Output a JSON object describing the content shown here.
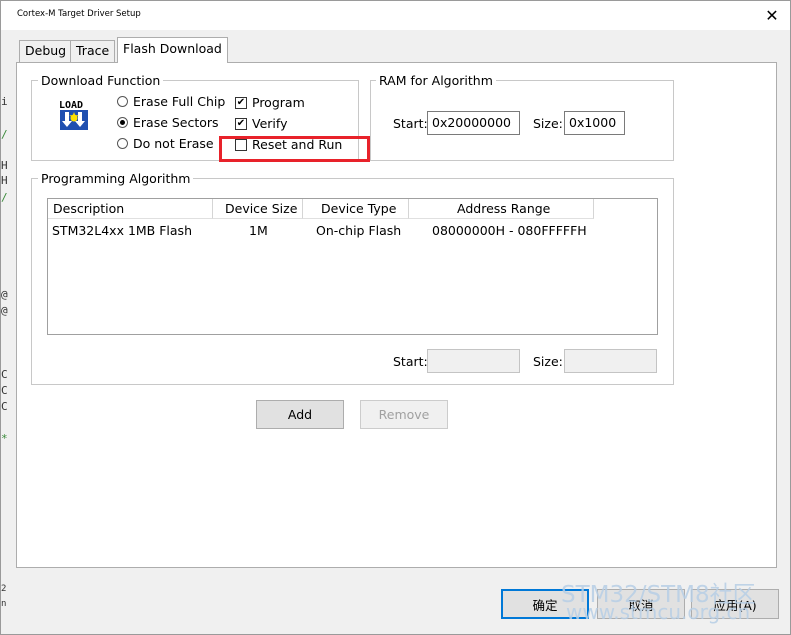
{
  "window": {
    "title": "Cortex-M Target Driver Setup",
    "close_glyph": "✕"
  },
  "background_remnants": [
    "i",
    "/",
    "H",
    "H",
    "/",
    "@",
    "@",
    "C",
    "C",
    "C",
    "*",
    "2",
    "n"
  ],
  "tabs": [
    {
      "label": "Debug",
      "active": false
    },
    {
      "label": "Trace",
      "active": false
    },
    {
      "label": "Flash Download",
      "active": true
    }
  ],
  "download_function": {
    "legend": "Download Function",
    "load_icon_text": "LOAD",
    "radios": [
      {
        "label": "Erase Full Chip",
        "selected": false
      },
      {
        "label": "Erase Sectors",
        "selected": true
      },
      {
        "label": "Do not Erase",
        "selected": false
      }
    ],
    "checkboxes": [
      {
        "label": "Program",
        "checked": true
      },
      {
        "label": "Verify",
        "checked": true
      },
      {
        "label": "Reset and Run",
        "checked": false
      }
    ]
  },
  "ram_for_algorithm": {
    "legend": "RAM for Algorithm",
    "start_label": "Start:",
    "start_value": "0x20000000",
    "size_label": "Size:",
    "size_value": "0x1000"
  },
  "programming_algorithm": {
    "legend": "Programming Algorithm",
    "columns": [
      "Description",
      "Device Size",
      "Device Type",
      "Address Range"
    ],
    "rows": [
      {
        "description": "STM32L4xx 1MB Flash",
        "device_size": "1M",
        "device_type": "On-chip Flash",
        "address_range": "08000000H - 080FFFFFH"
      }
    ],
    "start_label": "Start:",
    "start_value": "",
    "size_label": "Size:",
    "size_value": ""
  },
  "buttons": {
    "add": "Add",
    "remove": "Remove",
    "ok": "确定",
    "cancel": "取消",
    "apply": "应用(A)"
  },
  "watermark": {
    "line1": "STM32/STM8社区",
    "line2": "www.stmcu.org.cn"
  },
  "colors": {
    "highlight_box": "#e8222a",
    "default_button_border": "#0078d7"
  }
}
